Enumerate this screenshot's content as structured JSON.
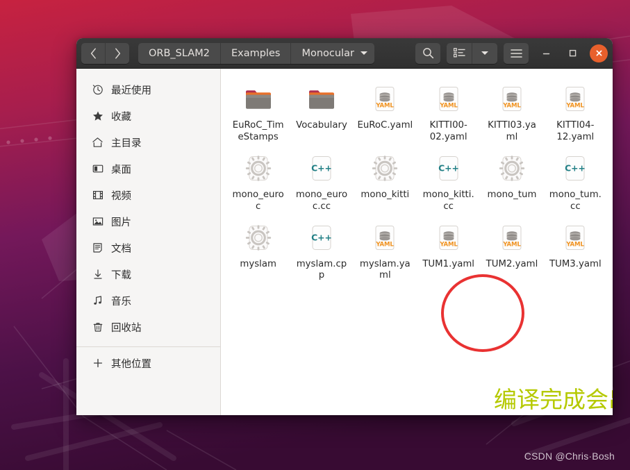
{
  "window": {
    "nav": {
      "back_icon": "chevron-left-icon",
      "forward_icon": "chevron-right-icon"
    },
    "breadcrumb": [
      {
        "label": "ORB_SLAM2"
      },
      {
        "label": "Examples"
      },
      {
        "label": "Monocular"
      }
    ],
    "toolbar": {
      "search_icon": "search-icon",
      "list_view_icon": "list-view-icon",
      "view_dropdown_icon": "chevron-down-icon",
      "menu_icon": "hamburger-menu-icon"
    },
    "controls": {
      "minimize_label": "—",
      "maximize_label": "□",
      "close_label": "✕",
      "close_color": "#e8602c"
    }
  },
  "sidebar": {
    "items": [
      {
        "label": "最近使用",
        "icon": "clock-icon"
      },
      {
        "label": "收藏",
        "icon": "star-icon"
      },
      {
        "label": "主目录",
        "icon": "home-icon"
      },
      {
        "label": "桌面",
        "icon": "desktop-icon"
      },
      {
        "label": "视频",
        "icon": "film-icon"
      },
      {
        "label": "图片",
        "icon": "picture-icon"
      },
      {
        "label": "文档",
        "icon": "document-icon"
      },
      {
        "label": "下载",
        "icon": "download-icon"
      },
      {
        "label": "音乐",
        "icon": "music-note-icon"
      },
      {
        "label": "回收站",
        "icon": "trash-icon"
      }
    ],
    "other": {
      "label": "其他位置",
      "icon": "plus-icon"
    }
  },
  "files": [
    {
      "name": "EuRoC_TimeStamps",
      "type": "folder"
    },
    {
      "name": "Vocabulary",
      "type": "folder"
    },
    {
      "name": "EuRoC.yaml",
      "type": "yaml"
    },
    {
      "name": "KITTI00-02.yaml",
      "type": "yaml"
    },
    {
      "name": "KITTI03.yaml",
      "type": "yaml"
    },
    {
      "name": "KITTI04-12.yaml",
      "type": "yaml"
    },
    {
      "name": "mono_euroc",
      "type": "executable"
    },
    {
      "name": "mono_euroc.cc",
      "type": "cpp"
    },
    {
      "name": "mono_kitti",
      "type": "executable"
    },
    {
      "name": "mono_kitti.cc",
      "type": "cpp"
    },
    {
      "name": "mono_tum",
      "type": "executable"
    },
    {
      "name": "mono_tum.cc",
      "type": "cpp"
    },
    {
      "name": "myslam",
      "type": "executable"
    },
    {
      "name": "myslam.cpp",
      "type": "cpp"
    },
    {
      "name": "myslam.yaml",
      "type": "yaml"
    },
    {
      "name": "TUM1.yaml",
      "type": "yaml"
    },
    {
      "name": "TUM2.yaml",
      "type": "yaml"
    },
    {
      "name": "TUM3.yaml",
      "type": "yaml"
    }
  ],
  "annotations": {
    "highlight_target": "myslam",
    "highlight_color": "#e93232",
    "note_text": "编译完成会出现myslam这个\n可执行文件",
    "note_color": "#b5c900"
  },
  "watermark": {
    "text": "CSDN @Chris·Bosh"
  },
  "icon_types": {
    "folder": "folder-icon",
    "yaml": "yaml-file-icon",
    "cpp": "cpp-file-icon",
    "executable": "executable-gear-icon"
  }
}
